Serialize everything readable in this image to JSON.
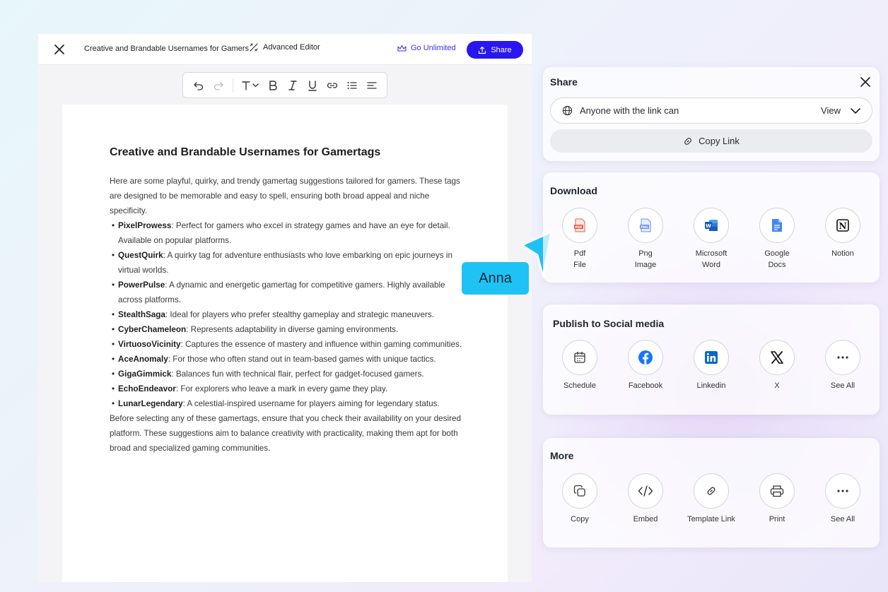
{
  "editor": {
    "title": "Creative and Brandable Usernames for Gamers",
    "advanced_editor": "Advanced Editor",
    "go_unlimited": "Go Unlimited",
    "share_label": "Share"
  },
  "document": {
    "heading": "Creative and Brandable Usernames for Gamertags",
    "intro": "Here are some playful, quirky, and trendy gamertag suggestions tailored for gamers. These tags are designed to be memorable and easy to spell, ensuring both broad appeal and niche specificity.",
    "items": [
      {
        "name": "PixelProwess",
        "desc": ": Perfect for gamers who excel in strategy games and have an eye for detail. Available on popular platforms."
      },
      {
        "name": "QuestQuirk",
        "desc": ": A quirky tag for adventure enthusiasts who love embarking on epic journeys in virtual worlds."
      },
      {
        "name": "PowerPulse",
        "desc": ": A dynamic and energetic gamertag for competitive gamers. Highly available across platforms."
      },
      {
        "name": "StealthSaga",
        "desc": ": Ideal for players who prefer stealthy gameplay and strategic maneuvers."
      },
      {
        "name": "CyberChameleon",
        "desc": ": Represents adaptability in diverse gaming environments."
      },
      {
        "name": "VirtuosoVicinity",
        "desc": ": Captures the essence of mastery and influence within gaming communities."
      },
      {
        "name": "AceAnomaly",
        "desc": ": For those who often stand out in team-based games with unique tactics."
      },
      {
        "name": "GigaGimmick",
        "desc": ": Balances fun with technical flair, perfect for gadget-focused gamers."
      },
      {
        "name": "EchoEndeavor",
        "desc": ": For explorers who leave a mark in every game they play."
      },
      {
        "name": "LunarLegendary",
        "desc": ": A celestial-inspired username for players aiming for legendary status."
      }
    ],
    "outro": "Before selecting any of these gamertags, ensure that you check their availability on your desired platform. These suggestions aim to balance creativity with practicality, making them apt for both broad and specialized gaming communities."
  },
  "cursor": {
    "name": "Anna",
    "color": "#1fc2f4"
  },
  "share": {
    "title": "Share",
    "access_text": "Anyone with the link can",
    "access_value": "View",
    "copy_link": "Copy Link"
  },
  "download": {
    "title": "Download",
    "items": [
      {
        "label": "Pdf\nFile",
        "icon": "pdf-icon"
      },
      {
        "label": "Png\nImage",
        "icon": "png-icon"
      },
      {
        "label": "Microsoft\nWord",
        "icon": "word-icon"
      },
      {
        "label": "Google\nDocs",
        "icon": "google-docs-icon"
      },
      {
        "label": "Notion",
        "icon": "notion-icon"
      }
    ]
  },
  "social": {
    "title": "Publish to Social media",
    "items": [
      {
        "label": "Schedule",
        "icon": "calendar-icon"
      },
      {
        "label": "Facebook",
        "icon": "facebook-icon"
      },
      {
        "label": "Linkedin",
        "icon": "linkedin-icon"
      },
      {
        "label": "X",
        "icon": "x-icon"
      },
      {
        "label": "See All",
        "icon": "more-icon"
      }
    ]
  },
  "more": {
    "title": "More",
    "items": [
      {
        "label": "Copy",
        "icon": "copy-icon"
      },
      {
        "label": "Embed",
        "icon": "code-icon"
      },
      {
        "label": "Template Link",
        "icon": "link-icon"
      },
      {
        "label": "Print",
        "icon": "print-icon"
      },
      {
        "label": "See All",
        "icon": "more-icon"
      }
    ]
  },
  "colors": {
    "brand": "#2a16ee",
    "accent_link": "#3b32e6"
  }
}
